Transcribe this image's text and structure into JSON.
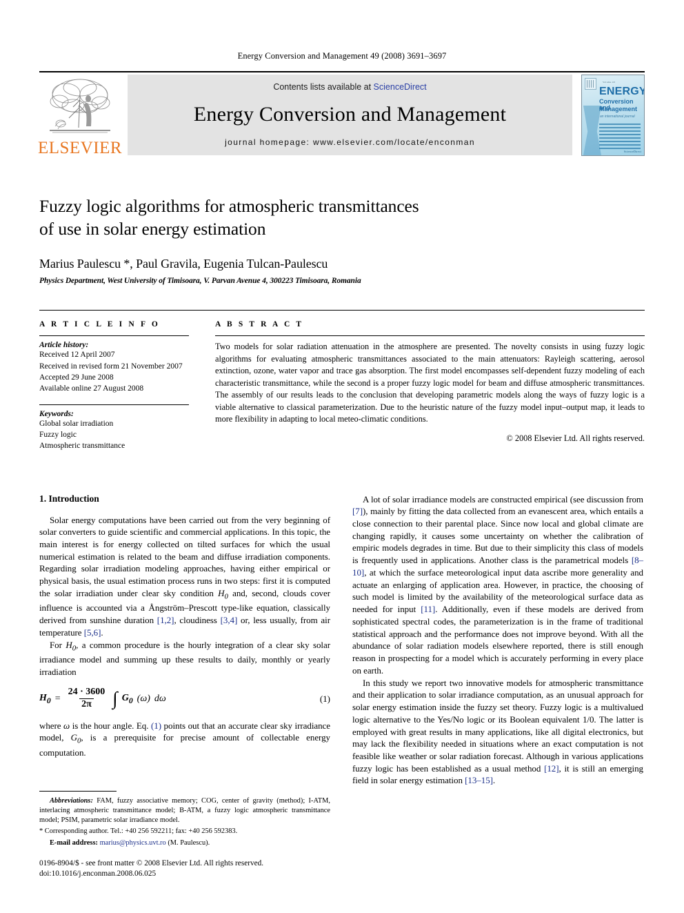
{
  "running_head": "Energy Conversion and Management 49 (2008) 3691–3697",
  "banner": {
    "publisher_name": "ELSEVIER",
    "contents_prefix": "Contents lists available at ",
    "contents_link": "ScienceDirect",
    "journal_title": "Energy Conversion and Management",
    "homepage": "journal homepage: www.elsevier.com/locate/enconman",
    "cover": {
      "kicker": "Volume 49",
      "line1": "ENERGY",
      "line2": "Conversion and",
      "line3": "Management",
      "tagline": "an international journal",
      "footer": "ScienceDirect"
    }
  },
  "article": {
    "title_line1": "Fuzzy logic algorithms for atmospheric transmittances",
    "title_line2": "of use in solar energy estimation",
    "authors": "Marius Paulescu *, Paul Gravila, Eugenia Tulcan-Paulescu",
    "affiliation": "Physics Department, West University of Timisoara, V. Parvan Avenue 4, 300223 Timisoara, Romania"
  },
  "info": {
    "heading": "A R T I C L E   I N F O",
    "history_label": "Article history:",
    "history": [
      "Received 12 April 2007",
      "Received in revised form 21 November 2007",
      "Accepted 29 June 2008",
      "Available online 27 August 2008"
    ],
    "keywords_label": "Keywords:",
    "keywords": [
      "Global solar irradiation",
      "Fuzzy logic",
      "Atmospheric transmittance"
    ]
  },
  "abstract": {
    "heading": "A B S T R A C T",
    "text": "Two models for solar radiation attenuation in the atmosphere are presented. The novelty consists in using fuzzy logic algorithms for evaluating atmospheric transmittances associated to the main attenuators: Rayleigh scattering, aerosol extinction, ozone, water vapor and trace gas absorption. The first model encompasses self-dependent fuzzy modeling of each characteristic transmittance, while the second is a proper fuzzy logic model for beam and diffuse atmospheric transmittances. The assembly of our results leads to the conclusion that developing parametric models along the ways of fuzzy logic is a viable alternative to classical parameterization. Due to the heuristic nature of the fuzzy model input–output map, it leads to more flexibility in adapting to local meteo-climatic conditions.",
    "copyright": "© 2008 Elsevier Ltd. All rights reserved."
  },
  "body": {
    "section1_title": "1. Introduction",
    "left_p1_a": "Solar energy computations have been carried out from the very beginning of solar converters to guide scientific and commercial applications. In this topic, the main interest is for energy collected on tilted surfaces for which the usual numerical estimation is related to the beam and diffuse irradiation components. Regarding solar irradiation modeling approaches, having either empirical or physical basis, the usual estimation process runs in two steps: first it is computed the solar irradiation under clear sky condition ",
    "left_p1_H0": "H",
    "left_p1_H0sub": "0",
    "left_p1_b": " and, second, clouds cover influence is accounted via a Ångström–Prescott type-like equation, classically derived from sunshine duration ",
    "ref_12": "[1,2]",
    "left_p1_c": ", cloudiness ",
    "ref_34": "[3,4]",
    "left_p1_d": " or, less usually, from air temperature ",
    "ref_56": "[5,6]",
    "left_p1_e": ".",
    "left_p2_a": "For ",
    "left_p2_b": ", a common procedure is the hourly integration of a clear sky solar irradiance model and summing up these results to daily, monthly or yearly irradiation",
    "equation": {
      "lhs": "H",
      "lhs_sub": "0",
      "eq": "=",
      "numerator": "24 · 3600",
      "denominator": "2π",
      "integral": "∫",
      "integrand": "G",
      "integrand_sub": "0",
      "integrand_arg": "(ω)",
      "differential": "dω",
      "number": "(1)"
    },
    "left_p3_a": "where ",
    "left_p3_omega": "ω",
    "left_p3_b": " is the hour angle. Eq. ",
    "left_p3_eqref": "(1)",
    "left_p3_c": " points out that an accurate clear sky irradiance model, ",
    "left_p3_G0": "G",
    "left_p3_G0sub": "0",
    "left_p3_d": ", is a prerequisite for precise amount of collectable energy computation.",
    "right_p1_a": "A lot of solar irradiance models are constructed empirical (see discussion from ",
    "ref_7": "[7]",
    "right_p1_b": "), mainly by fitting the data collected from an evanescent area, which entails a close connection to their parental place. Since now local and global climate are changing rapidly, it causes some uncertainty on whether the calibration of empiric models degrades in time. But due to their simplicity this class of models is frequently used in applications. Another class is the parametrical models ",
    "ref_810": "[8–10]",
    "right_p1_c": ", at which the surface meteorological input data ascribe more generality and actuate an enlarging of application area. However, in practice, the choosing of such model is limited by the availability of the meteorological surface data as needed for input ",
    "ref_11": "[11]",
    "right_p1_d": ". Additionally, even if these models are derived from sophisticated spectral codes, the parameterization is in the frame of traditional statistical approach and the performance does not improve beyond. With all the abundance of solar radiation models elsewhere reported, there is still enough reason in prospecting for a model which is accurately performing in every place on earth.",
    "right_p2_a": "In this study we report two innovative models for atmospheric transmittance and their application to solar irradiance computation, as an unusual approach for solar energy estimation inside the fuzzy set theory. Fuzzy logic is a multivalued logic alternative to the Yes/No logic or its Boolean equivalent 1/0. The latter is employed with great results in many applications, like all digital electronics, but may lack the flexibility needed in situations where an exact computation is not feasible like weather or solar radiation forecast. Although in various applications fuzzy logic has been established as a usual method ",
    "ref_12b": "[12]",
    "right_p2_b": ", it is still an emerging field in solar energy estimation ",
    "ref_1315": "[13–15]",
    "right_p2_c": "."
  },
  "footnotes": {
    "abbrev_label": "Abbreviations:",
    "abbrev_text": " FAM, fuzzy associative memory; COG, center of gravity (method); I-ATM, interlacing atmospheric transmittance model; B-ATM, a fuzzy logic atmospheric transmittance model; PSIM, parametric solar irradiance model.",
    "corresponding": "Corresponding author. Tel.: +40 256 592211; fax: +40 256 592383.",
    "email_label": "E-mail address:",
    "email": "marius@physics.uvt.ro",
    "email_suffix": " (M. Paulescu).",
    "issn_line": "0196-8904/$ - see front matter © 2008 Elsevier Ltd. All rights reserved.",
    "doi_line": "doi:10.1016/j.enconman.2008.06.025"
  },
  "colors": {
    "elsevier_orange": "#E87722",
    "link_blue": "#2a3fa5",
    "reference_blue": "#1b2f8a",
    "banner_grey": "#e3e3e3"
  }
}
